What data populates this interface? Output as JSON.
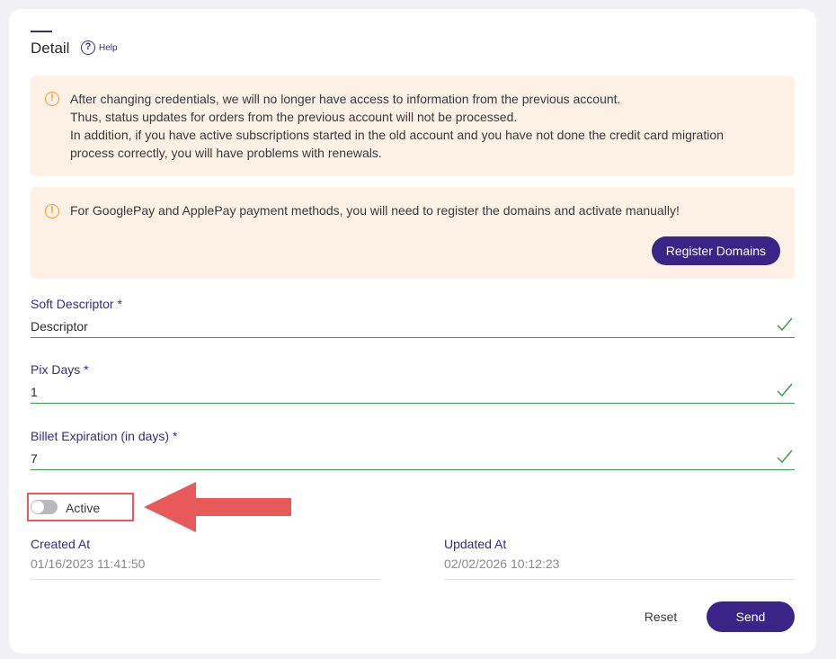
{
  "header": {
    "title": "Detail",
    "help_label": "Help"
  },
  "alerts": [
    {
      "lines": [
        "After changing credentials, we will no longer have access to information from the previous account.",
        "Thus, status updates for orders from the previous account will not be processed.",
        "In addition, if you have active subscriptions started in the old account and you have not done the credit card migration",
        "process correctly, you will have problems with renewals."
      ]
    },
    {
      "lines": [
        "For GooglePay and ApplePay payment methods, you will need to register the domains and activate manually!"
      ],
      "button_label": "Register Domains"
    }
  ],
  "fields": [
    {
      "label": "Soft Descriptor *",
      "value": "Descriptor"
    },
    {
      "label": "Pix Days *",
      "value": "1"
    },
    {
      "label": "Billet Expiration (in days) *",
      "value": "7"
    }
  ],
  "toggle": {
    "label": "Active",
    "on": false
  },
  "meta": {
    "created_label": "Created At",
    "created_value": "01/16/2023 11:41:50",
    "updated_label": "Updated At",
    "updated_value": "02/02/2026 10:12:23"
  },
  "actions": {
    "reset_label": "Reset",
    "send_label": "Send"
  },
  "colors": {
    "primary": "#3a2586",
    "valid": "#3e9a52",
    "warning": "#f09a2a",
    "annotation": "#e85a5a"
  }
}
